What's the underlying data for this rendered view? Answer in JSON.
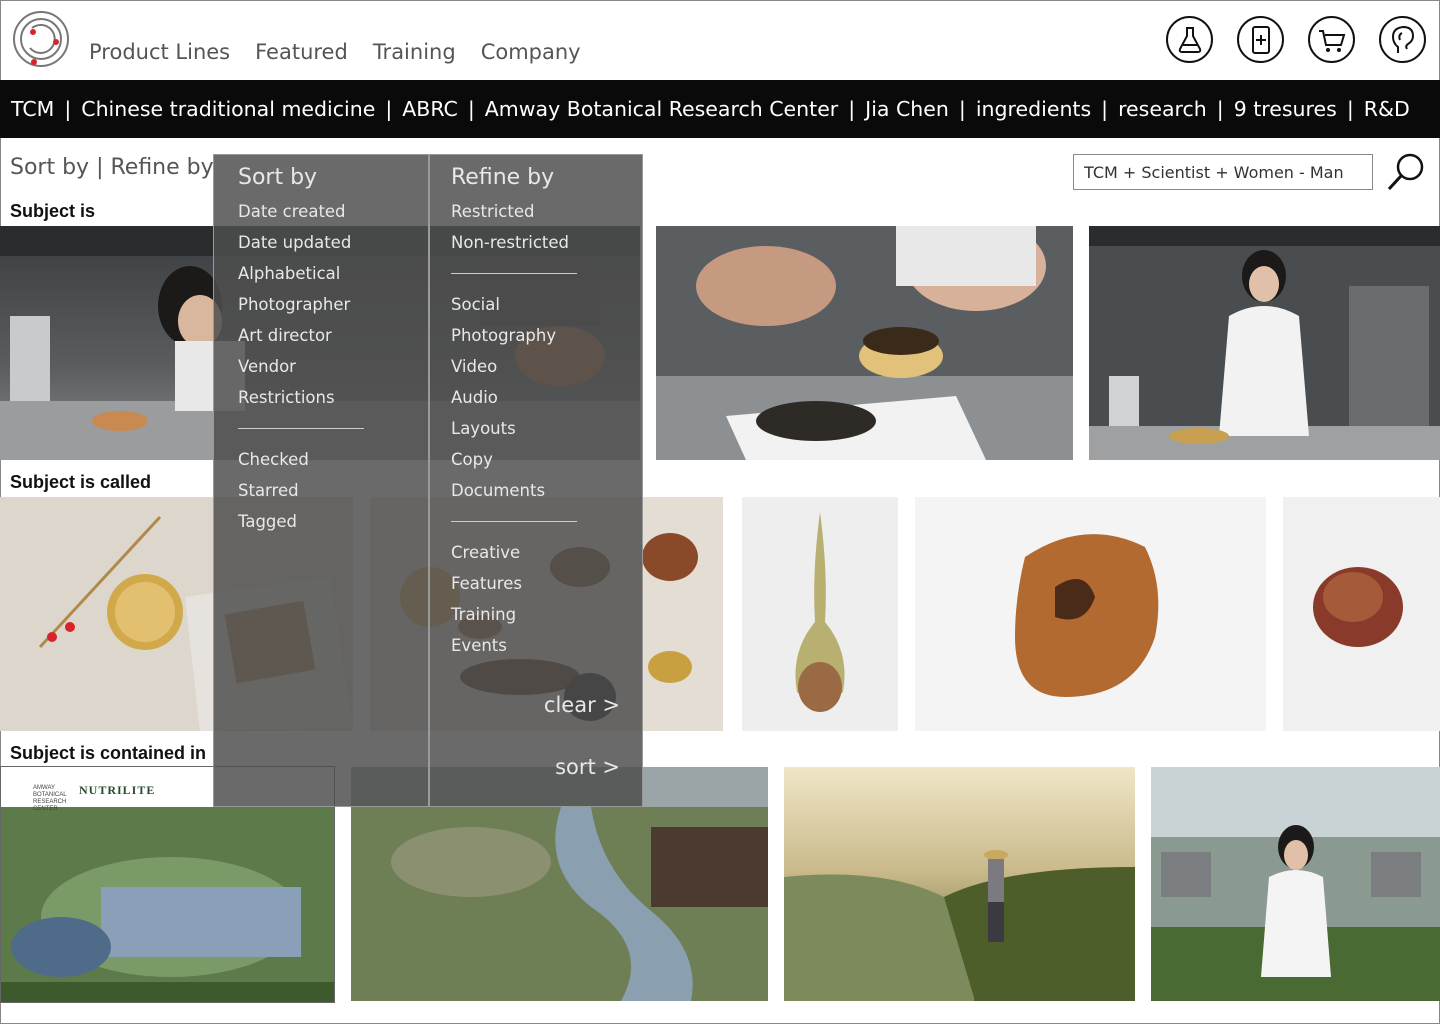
{
  "nav": {
    "items": [
      "Product Lines",
      "Featured",
      "Training",
      "Company"
    ]
  },
  "top_icons": [
    "flask-icon",
    "phone-plus-icon",
    "cart-icon",
    "profile-head-icon"
  ],
  "tags": [
    "TCM",
    "Chinese traditional medicine",
    "ABRC",
    "Amway Botanical Research Center",
    "Jia Chen",
    "ingredients",
    "research",
    "9 tresures",
    "R&D"
  ],
  "sort_refine": {
    "sort_label": "Sort by",
    "sep": " | ",
    "refine_label": "Refine by"
  },
  "search": {
    "value": "TCM + Scientist + Women - Man"
  },
  "sections": {
    "s1": "Subject is",
    "s2": "Subject is called",
    "s3": "Subject is contained in"
  },
  "panel": {
    "sort_title": "Sort by",
    "sort_options": [
      "Date created",
      "Date updated",
      "Alphabetical",
      "Photographer",
      "Art director",
      "Vendor",
      "Restrictions"
    ],
    "sort_options_2": [
      "Checked",
      "Starred",
      "Tagged"
    ],
    "refine_title": "Refine by",
    "refine_group1": [
      "Restricted",
      "Non-restricted"
    ],
    "refine_group2": [
      "Social",
      "Photography",
      "Video",
      "Audio",
      "Layouts",
      "Copy",
      "Documents"
    ],
    "refine_group3": [
      "Creative",
      "Features",
      "Training",
      "Events"
    ],
    "clear_label": "clear >",
    "sort_label": "sort >"
  },
  "logo_text": {
    "line1": "AMWAY BOTANICAL RESEARCH CENTER",
    "brand": "NUTRILITE"
  },
  "colors": {
    "accent": "#d8232a",
    "bar": "#0a0a0a"
  }
}
